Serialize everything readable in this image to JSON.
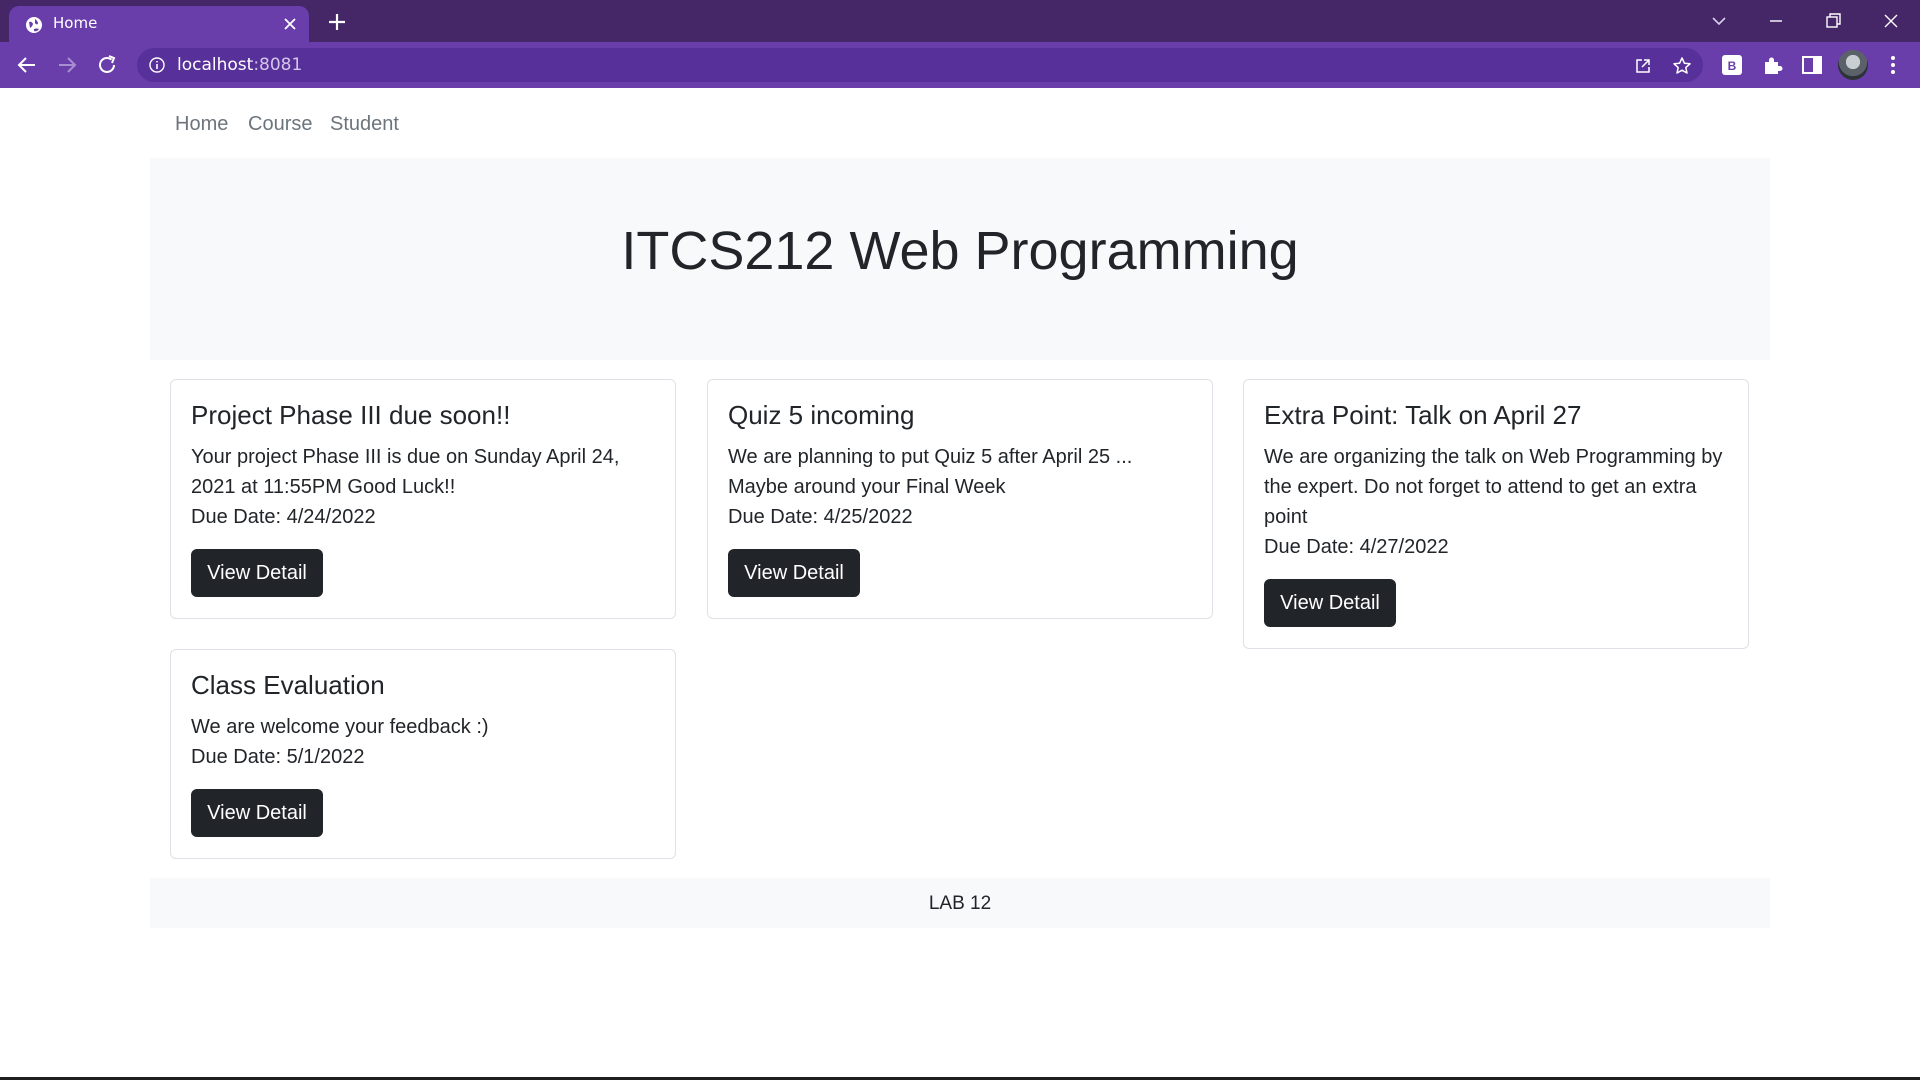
{
  "browser": {
    "tab_title": "Home",
    "url_host": "localhost",
    "url_port": ":8081",
    "theme_colors": {
      "tabbar": "#452667",
      "toolbar": "#6a3eaa",
      "omnibox": "#58309a"
    },
    "icons": [
      "globe-icon",
      "tab-close-icon",
      "new-tab-icon",
      "tab-search-icon",
      "minimize-icon",
      "restore-icon",
      "window-close-icon",
      "back-icon",
      "forward-icon",
      "reload-icon",
      "site-info-icon",
      "share-icon",
      "bookmark-star-icon",
      "extension-b-icon",
      "extensions-puzzle-icon",
      "side-panel-icon",
      "profile-avatar",
      "more-menu-icon"
    ]
  },
  "nav": {
    "links": [
      "Home",
      "Course",
      "Student"
    ]
  },
  "hero": {
    "title": "ITCS212 Web Programming"
  },
  "cards": [
    {
      "title": "Project Phase III due soon!!",
      "text": "Your project Phase III is due on Sunday April 24, 2021 at 11:55PM Good Luck!!",
      "due": "Due Date: 4/24/2022",
      "button": "View Detail"
    },
    {
      "title": "Quiz 5 incoming",
      "text": "We are planning to put Quiz 5 after April 25 ... Maybe around your Final Week",
      "due": "Due Date: 4/25/2022",
      "button": "View Detail"
    },
    {
      "title": "Extra Point: Talk on April 27",
      "text": "We are organizing the talk on Web Programming by the expert. Do not forget to attend to get an extra point",
      "due": "Due Date: 4/27/2022",
      "button": "View Detail"
    },
    {
      "title": "Class Evaluation",
      "text": "We are welcome your feedback :)",
      "due": "Due Date: 5/1/2022",
      "button": "View Detail"
    }
  ],
  "footer": {
    "text": "LAB 12"
  }
}
